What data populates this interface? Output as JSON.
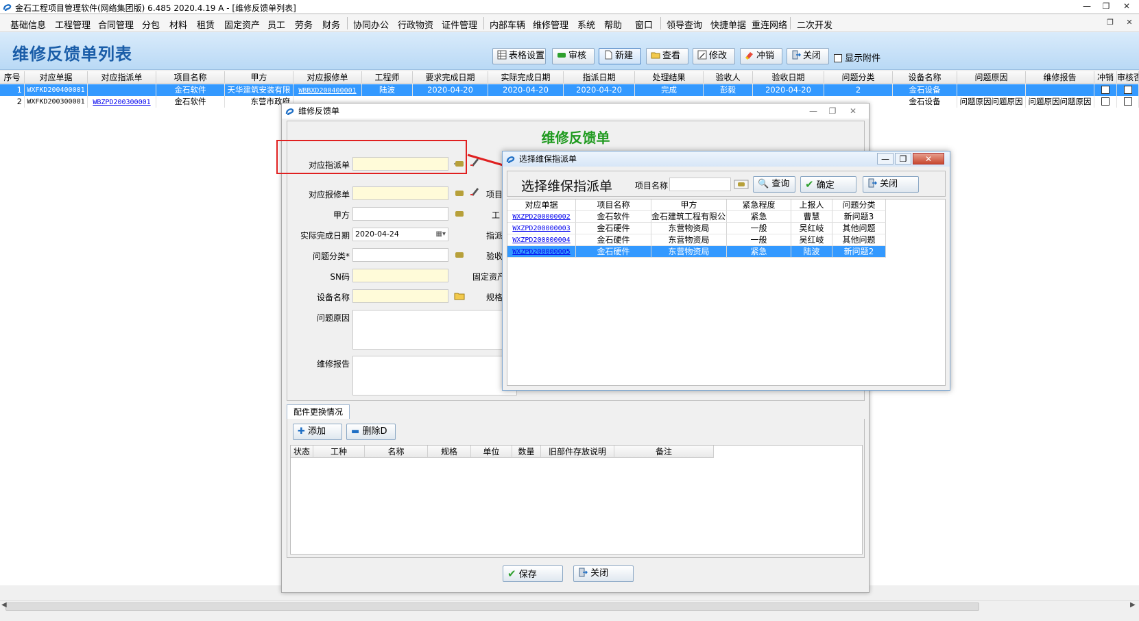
{
  "titlebar": {
    "title": "金石工程项目管理软件(网络集团版) 6.485  2020.4.19 A - [维修反馈单列表]"
  },
  "menubar": {
    "items": [
      "基础信息",
      "工程管理",
      "合同管理",
      "分包",
      "材料",
      "租赁",
      "固定资产",
      "员工",
      "劳务",
      "财务",
      "协同办公",
      "行政物资",
      "证件管理",
      "内部车辆",
      "维修管理",
      "系统",
      "帮助",
      "窗口",
      "领导查询",
      "快捷单据",
      "重连网络",
      "二次开发"
    ]
  },
  "header": {
    "page_title": "维修反馈单列表",
    "buttons": {
      "grid_settings": "表格设置",
      "audit": "审核",
      "new": "新建",
      "view": "查看",
      "edit": "修改",
      "reverse": "冲销",
      "close": "关闭"
    },
    "show_attachments": "显示附件"
  },
  "main_grid": {
    "columns": [
      "序号",
      "对应单据",
      "对应指派单",
      "项目名称",
      "甲方",
      "对应报修单",
      "工程师",
      "要求完成日期",
      "实际完成日期",
      "指派日期",
      "处理结果",
      "验收人",
      "验收日期",
      "问题分类",
      "设备名称",
      "问题原因",
      "维修报告",
      "冲销",
      "审核否"
    ],
    "rows": [
      {
        "no": "1",
        "doc": "WXFKD200400001",
        "assign": "",
        "project": "金石软件",
        "party": "天华建筑安装有限",
        "repair": "WBBXD200400001",
        "engineer": "陆波",
        "req_date": "2020-04-20",
        "act_date": "2020-04-20",
        "assign_date": "2020-04-20",
        "result": "完成",
        "acceptor": "彭毅",
        "accept_date": "2020-04-20",
        "category": "2",
        "device": "金石设备",
        "cause": "",
        "report": ""
      },
      {
        "no": "2",
        "doc": "WXFKD200300001",
        "assign": "WBZPD200300001",
        "project": "金石软件",
        "party": "东营市政府",
        "repair": "",
        "engineer": "",
        "req_date": "",
        "act_date": "",
        "assign_date": "",
        "result": "",
        "acceptor": "",
        "accept_date": "",
        "category": "",
        "device": "金石设备",
        "cause": "问题原因问题原因",
        "report": "问题原因问题原因"
      }
    ]
  },
  "form_window": {
    "title": "维修反馈单",
    "heading": "维修反馈单",
    "labels": {
      "assign": "对应指派单",
      "repair": "对应报修单",
      "party": "甲方",
      "actual_date": "实际完成日期",
      "category": "问题分类*",
      "sn": "SN码",
      "device": "设备名称",
      "cause": "问题原因",
      "report": "维修报告",
      "project_partial": "项目",
      "eng_partial": "工",
      "assign_partial": "指派",
      "accept_partial": "验收",
      "fixed_asset_partial": "固定资产",
      "spec_partial": "规格"
    },
    "values": {
      "actual_date": "2020-04-24"
    },
    "tab": "配件更换情况",
    "sub_buttons": {
      "add": "添加",
      "delete": "删除D"
    },
    "sub_columns": [
      "状态",
      "工种",
      "名称",
      "规格",
      "单位",
      "数量",
      "旧部件存放说明",
      "备注"
    ],
    "footer_buttons": {
      "save": "保存",
      "close": "关闭"
    }
  },
  "select_dialog": {
    "title": "选择维保指派单",
    "heading": "选择维保指派单",
    "project_label": "项目名称",
    "buttons": {
      "query": "查询",
      "ok": "确定",
      "close": "关闭"
    },
    "columns": [
      "对应单据",
      "项目名称",
      "甲方",
      "紧急程度",
      "上报人",
      "问题分类"
    ],
    "rows": [
      {
        "doc": "WXZPD200000002",
        "project": "金石软件",
        "party": "金石建筑工程有限公司",
        "urgency": "紧急",
        "reporter": "曹慧",
        "category": "新问题3"
      },
      {
        "doc": "WXZPD200000003",
        "project": "金石硬件",
        "party": "东营物资局",
        "urgency": "一般",
        "reporter": "吴红岐",
        "category": "其他问题"
      },
      {
        "doc": "WXZPD200000004",
        "project": "金石硬件",
        "party": "东营物资局",
        "urgency": "一般",
        "reporter": "吴红岐",
        "category": "其他问题"
      },
      {
        "doc": "WXZPD200000005",
        "project": "金石硬件",
        "party": "东营物资局",
        "urgency": "紧急",
        "reporter": "陆波",
        "category": "新问题2"
      }
    ],
    "selected_row": 3
  },
  "colors": {
    "accent": "#1a5da8",
    "selection": "#3399ff",
    "form_heading": "#1f9a1f",
    "annotation": "#e02020"
  }
}
